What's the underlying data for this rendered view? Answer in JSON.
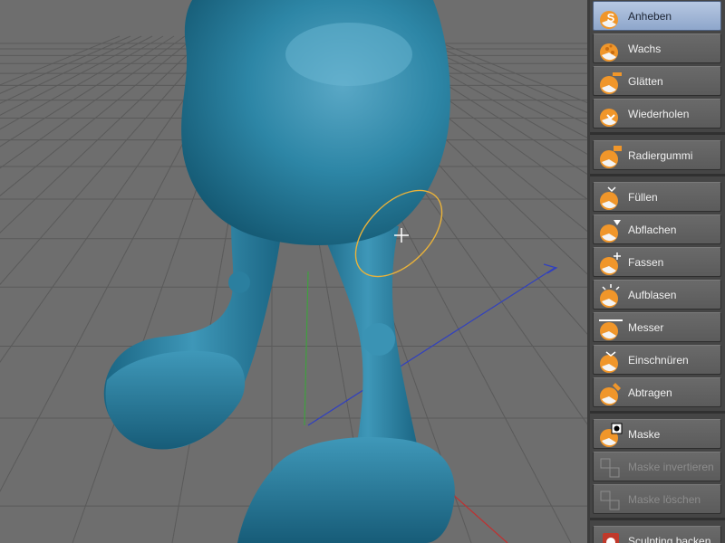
{
  "tools": [
    {
      "label": "Anheben",
      "icon": "lift-brush-icon",
      "active": true,
      "disabled": false
    },
    {
      "label": "Wachs",
      "icon": "wax-brush-icon",
      "active": false,
      "disabled": false
    },
    {
      "label": "Glätten",
      "icon": "smooth-brush-icon",
      "active": false,
      "disabled": false
    },
    {
      "label": "Wiederholen",
      "icon": "repeat-brush-icon",
      "active": false,
      "disabled": false
    },
    {
      "label": "Radiergummi",
      "icon": "eraser-brush-icon",
      "active": false,
      "disabled": false
    },
    {
      "label": "Füllen",
      "icon": "fill-brush-icon",
      "active": false,
      "disabled": false
    },
    {
      "label": "Abflachen",
      "icon": "flatten-brush-icon",
      "active": false,
      "disabled": false
    },
    {
      "label": "Fassen",
      "icon": "grab-brush-icon",
      "active": false,
      "disabled": false
    },
    {
      "label": "Aufblasen",
      "icon": "inflate-brush-icon",
      "active": false,
      "disabled": false
    },
    {
      "label": "Messer",
      "icon": "knife-brush-icon",
      "active": false,
      "disabled": false
    },
    {
      "label": "Einschnüren",
      "icon": "pinch-brush-icon",
      "active": false,
      "disabled": false
    },
    {
      "label": "Abtragen",
      "icon": "scrape-brush-icon",
      "active": false,
      "disabled": false
    },
    {
      "label": "Maske",
      "icon": "mask-brush-icon",
      "active": false,
      "disabled": false
    },
    {
      "label": "Maske invertieren",
      "icon": "invert-mask-icon",
      "active": false,
      "disabled": true
    },
    {
      "label": "Maske löschen",
      "icon": "clear-mask-icon",
      "active": false,
      "disabled": true
    },
    {
      "label": "Sculpting backen...",
      "icon": "bake-sculpt-icon",
      "active": false,
      "disabled": false
    }
  ],
  "colors": {
    "model": "#2b7f9f",
    "brush_ring": "#e9b23a",
    "active_tool": "#9bb1d4",
    "icon_orange": "#f0962a"
  }
}
